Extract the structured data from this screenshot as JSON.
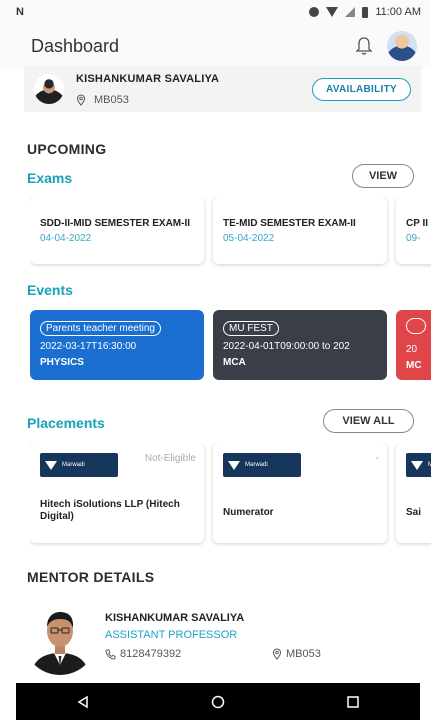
{
  "status_bar": {
    "carrier_icon": "N",
    "time": "11:00 AM"
  },
  "app_bar": {
    "title": "Dashboard",
    "notification_icon": "bell-icon"
  },
  "profile": {
    "name": "KISHANKUMAR SAVALIYA",
    "location": "MB053",
    "availability_label": "AVAILABILITY"
  },
  "upcoming": {
    "heading": "UPCOMING",
    "exams_label": "Exams",
    "view_label": "VIEW",
    "exams": [
      {
        "title": "SDD-II-MID SEMESTER EXAM-II",
        "date": "04-04-2022"
      },
      {
        "title": "TE-MID SEMESTER EXAM-II",
        "date": "05-04-2022"
      },
      {
        "title": "CP II",
        "date": "09-"
      }
    ]
  },
  "events": {
    "label": "Events",
    "items": [
      {
        "name": "Parents teacher meeting",
        "time": "2022-03-17T16:30:00",
        "dept": "PHYSICS",
        "color": "#1a6fd1"
      },
      {
        "name": "MU FEST",
        "time": "2022-04-01T09:00:00 to 202",
        "dept": "MCA",
        "color": "#3a3f47"
      },
      {
        "name": "",
        "time": "20",
        "dept": "MC",
        "color": "#e0454a"
      }
    ]
  },
  "placements": {
    "label": "Placements",
    "view_all_label": "VIEW ALL",
    "items": [
      {
        "company": "Hitech iSolutions LLP (Hitech Digital)",
        "eligibility": "Not-Eligible"
      },
      {
        "company": "Numerator",
        "eligibility": "-"
      },
      {
        "company": "Sai",
        "eligibility": ""
      }
    ]
  },
  "mentor": {
    "heading": "MENTOR DETAILS",
    "name": "KISHANKUMAR SAVALIYA",
    "role": "ASSISTANT PROFESSOR",
    "phone": "8128479392",
    "room": "MB053"
  },
  "colors": {
    "accent": "#17a2b8",
    "event_blue": "#1a6fd1",
    "event_dark": "#3a3f47",
    "event_red": "#e0454a"
  }
}
